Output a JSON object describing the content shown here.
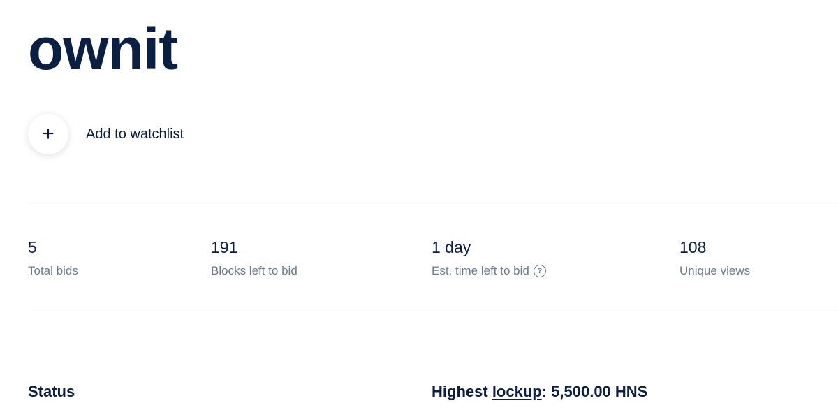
{
  "domain": {
    "name": "ownit"
  },
  "watchlist": {
    "button_symbol": "+",
    "label": "Add to watchlist"
  },
  "stats": [
    {
      "value": "5",
      "label": "Total bids"
    },
    {
      "value": "191",
      "label": "Blocks left to bid"
    },
    {
      "value": "1 day",
      "label": "Est. time left to bid",
      "help_icon": "question-circle-icon"
    },
    {
      "value": "108",
      "label": "Unique views"
    }
  ],
  "status": {
    "heading": "Status"
  },
  "highest_lockup": {
    "prefix": "Highest",
    "link_text": "lockup",
    "suffix": ": 5,500.00 HNS"
  },
  "colors": {
    "primary_text": "#0b1f45",
    "muted_text": "#6b7a90",
    "divider": "#d6dae1",
    "background": "#ffffff"
  }
}
